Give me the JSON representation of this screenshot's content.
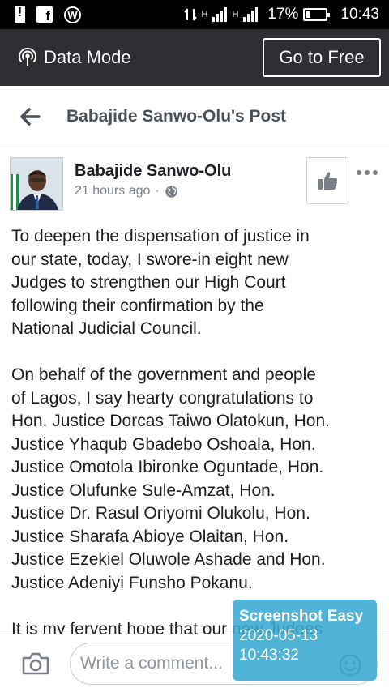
{
  "status_bar": {
    "battery": "17%",
    "time": "10:43",
    "network_small_1": "H",
    "network_small_2": "H"
  },
  "data_mode": {
    "label": "Data Mode",
    "button": "Go to Free"
  },
  "header": {
    "title": "Babajide Sanwo-Olu's Post"
  },
  "post": {
    "author": "Babajide Sanwo-Olu",
    "time": "21 hours ago",
    "separator": "·",
    "body": "To deepen the dispensation of justice in\nour state, today, I swore-in eight new\nJudges to strengthen our High Court\nfollowing their confirmation by the\nNational Judicial Council.\n\nOn behalf of the government and people\nof Lagos, I say hearty congratulations to\nHon. Justice Dorcas Taiwo Olatokun, Hon.\nJustice Yhaqub Gbadebo Oshoala, Hon.\nJustice Omotola Ibironke Oguntade, Hon.\nJustice Olufunke Sule-Amzat, Hon.\nJustice Dr. Rasul Oriyomi Olukolu, Hon.\nJustice Sharafa Abioye Olaitan, Hon.\nJustice Ezekiel Oluwole Ashade and Hon.\nJustice Adeniyi Funsho Pokanu.\n\nIt is my fervent hope that our new Judges"
  },
  "composer": {
    "placeholder": "Write a comment..."
  },
  "overlay": {
    "app": "Screenshot Easy",
    "date": "2020-05-13",
    "time": "10:43:32"
  },
  "icons": {
    "alert": "alert-icon",
    "facebook": "facebook-icon",
    "wordpress": "wordpress-icon",
    "data_mode": "broadcast-icon",
    "back": "back-arrow-icon",
    "like": "thumbs-up-icon",
    "more": "more-dots-icon",
    "privacy": "globe-icon",
    "camera": "camera-icon",
    "emoji": "emoji-icon"
  },
  "colors": {
    "status_bar": "#000000",
    "mode_bar": "#2d2f33",
    "overlay": "#37aad2",
    "meta_text": "#7a7f87"
  }
}
